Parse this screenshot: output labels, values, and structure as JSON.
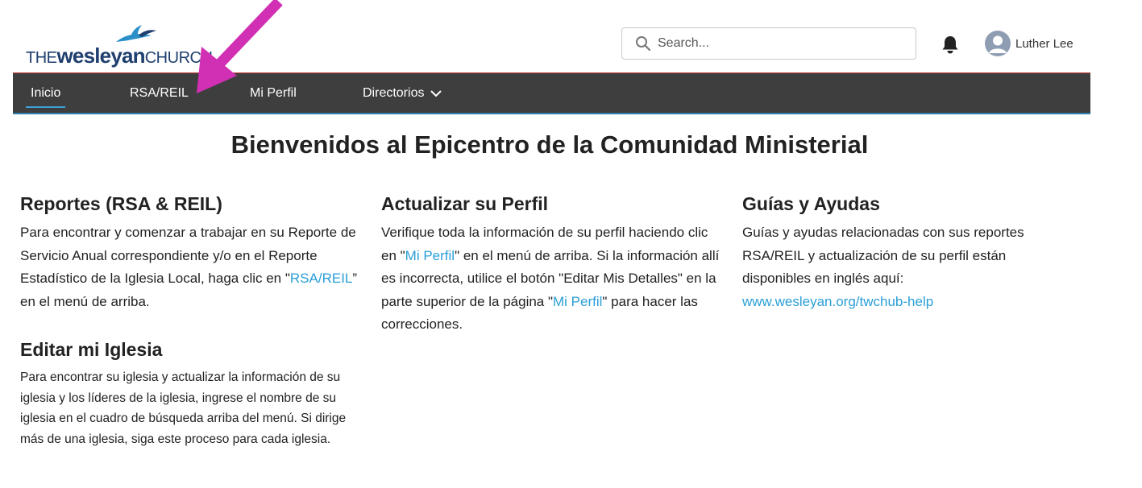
{
  "logo": {
    "the": "THE",
    "wesleyan": "wesleyan",
    "church": "CHURCH"
  },
  "search": {
    "placeholder": "Search..."
  },
  "user": {
    "name": "Luther Lee"
  },
  "nav": [
    {
      "label": "Inicio"
    },
    {
      "label": "RSA/REIL"
    },
    {
      "label": "Mi Perfil"
    },
    {
      "label": "Directorios"
    }
  ],
  "page_title": "Bienvenidos al Epicentro de la Comunidad Ministerial",
  "sections": {
    "reportes": {
      "heading": "Reportes (RSA & REIL)",
      "text_before": "Para encontrar y comenzar a trabajar en su Reporte de Servicio Anual correspondiente y/o en el Reporte Estadístico de la Iglesia Local, haga clic en \"",
      "link": "RSA/REIL",
      "text_after": "” en el menú de arriba."
    },
    "perfil": {
      "heading": "Actualizar su Perfil",
      "text_1": "Verifique toda la información de su perfil haciendo clic en \"",
      "link_1": "Mi Perfil",
      "text_2": "\" en el menú de arriba. Si la información allí es incorrecta, utilice el botón \"Editar Mis Detalles\" en la parte superior de la página \"",
      "link_2": "Mi Perfil",
      "text_3": "\" para hacer las correcciones."
    },
    "guias": {
      "heading": "Guías y Ayudas",
      "text": "Guías y ayudas relacionadas con sus reportes RSA/REIL y actualización de su perfil están disponibles en inglés aquí:",
      "link": "www.wesleyan.org/twchub-help"
    },
    "editar": {
      "heading": "Editar mi Iglesia",
      "text": "Para encontrar su iglesia y actualizar la información de su iglesia y los líderes de la iglesia, ingrese el nombre de su iglesia en el cuadro de búsqueda arriba del menú. Si dirige más de una iglesia, siga este proceso para cada iglesia."
    }
  },
  "colors": {
    "nav_bg": "#3e3e3e",
    "link": "#2b9fd7",
    "active_underline": "#3ba1d9",
    "annotation_arrow": "#d12fb4",
    "brand_navy": "#1f3f6e",
    "brand_blue": "#2b8fc9"
  },
  "icons": [
    "search-icon",
    "bell-icon",
    "user-avatar-icon",
    "chevron-down-icon",
    "flame-dove-logo-icon",
    "annotation-arrow"
  ]
}
